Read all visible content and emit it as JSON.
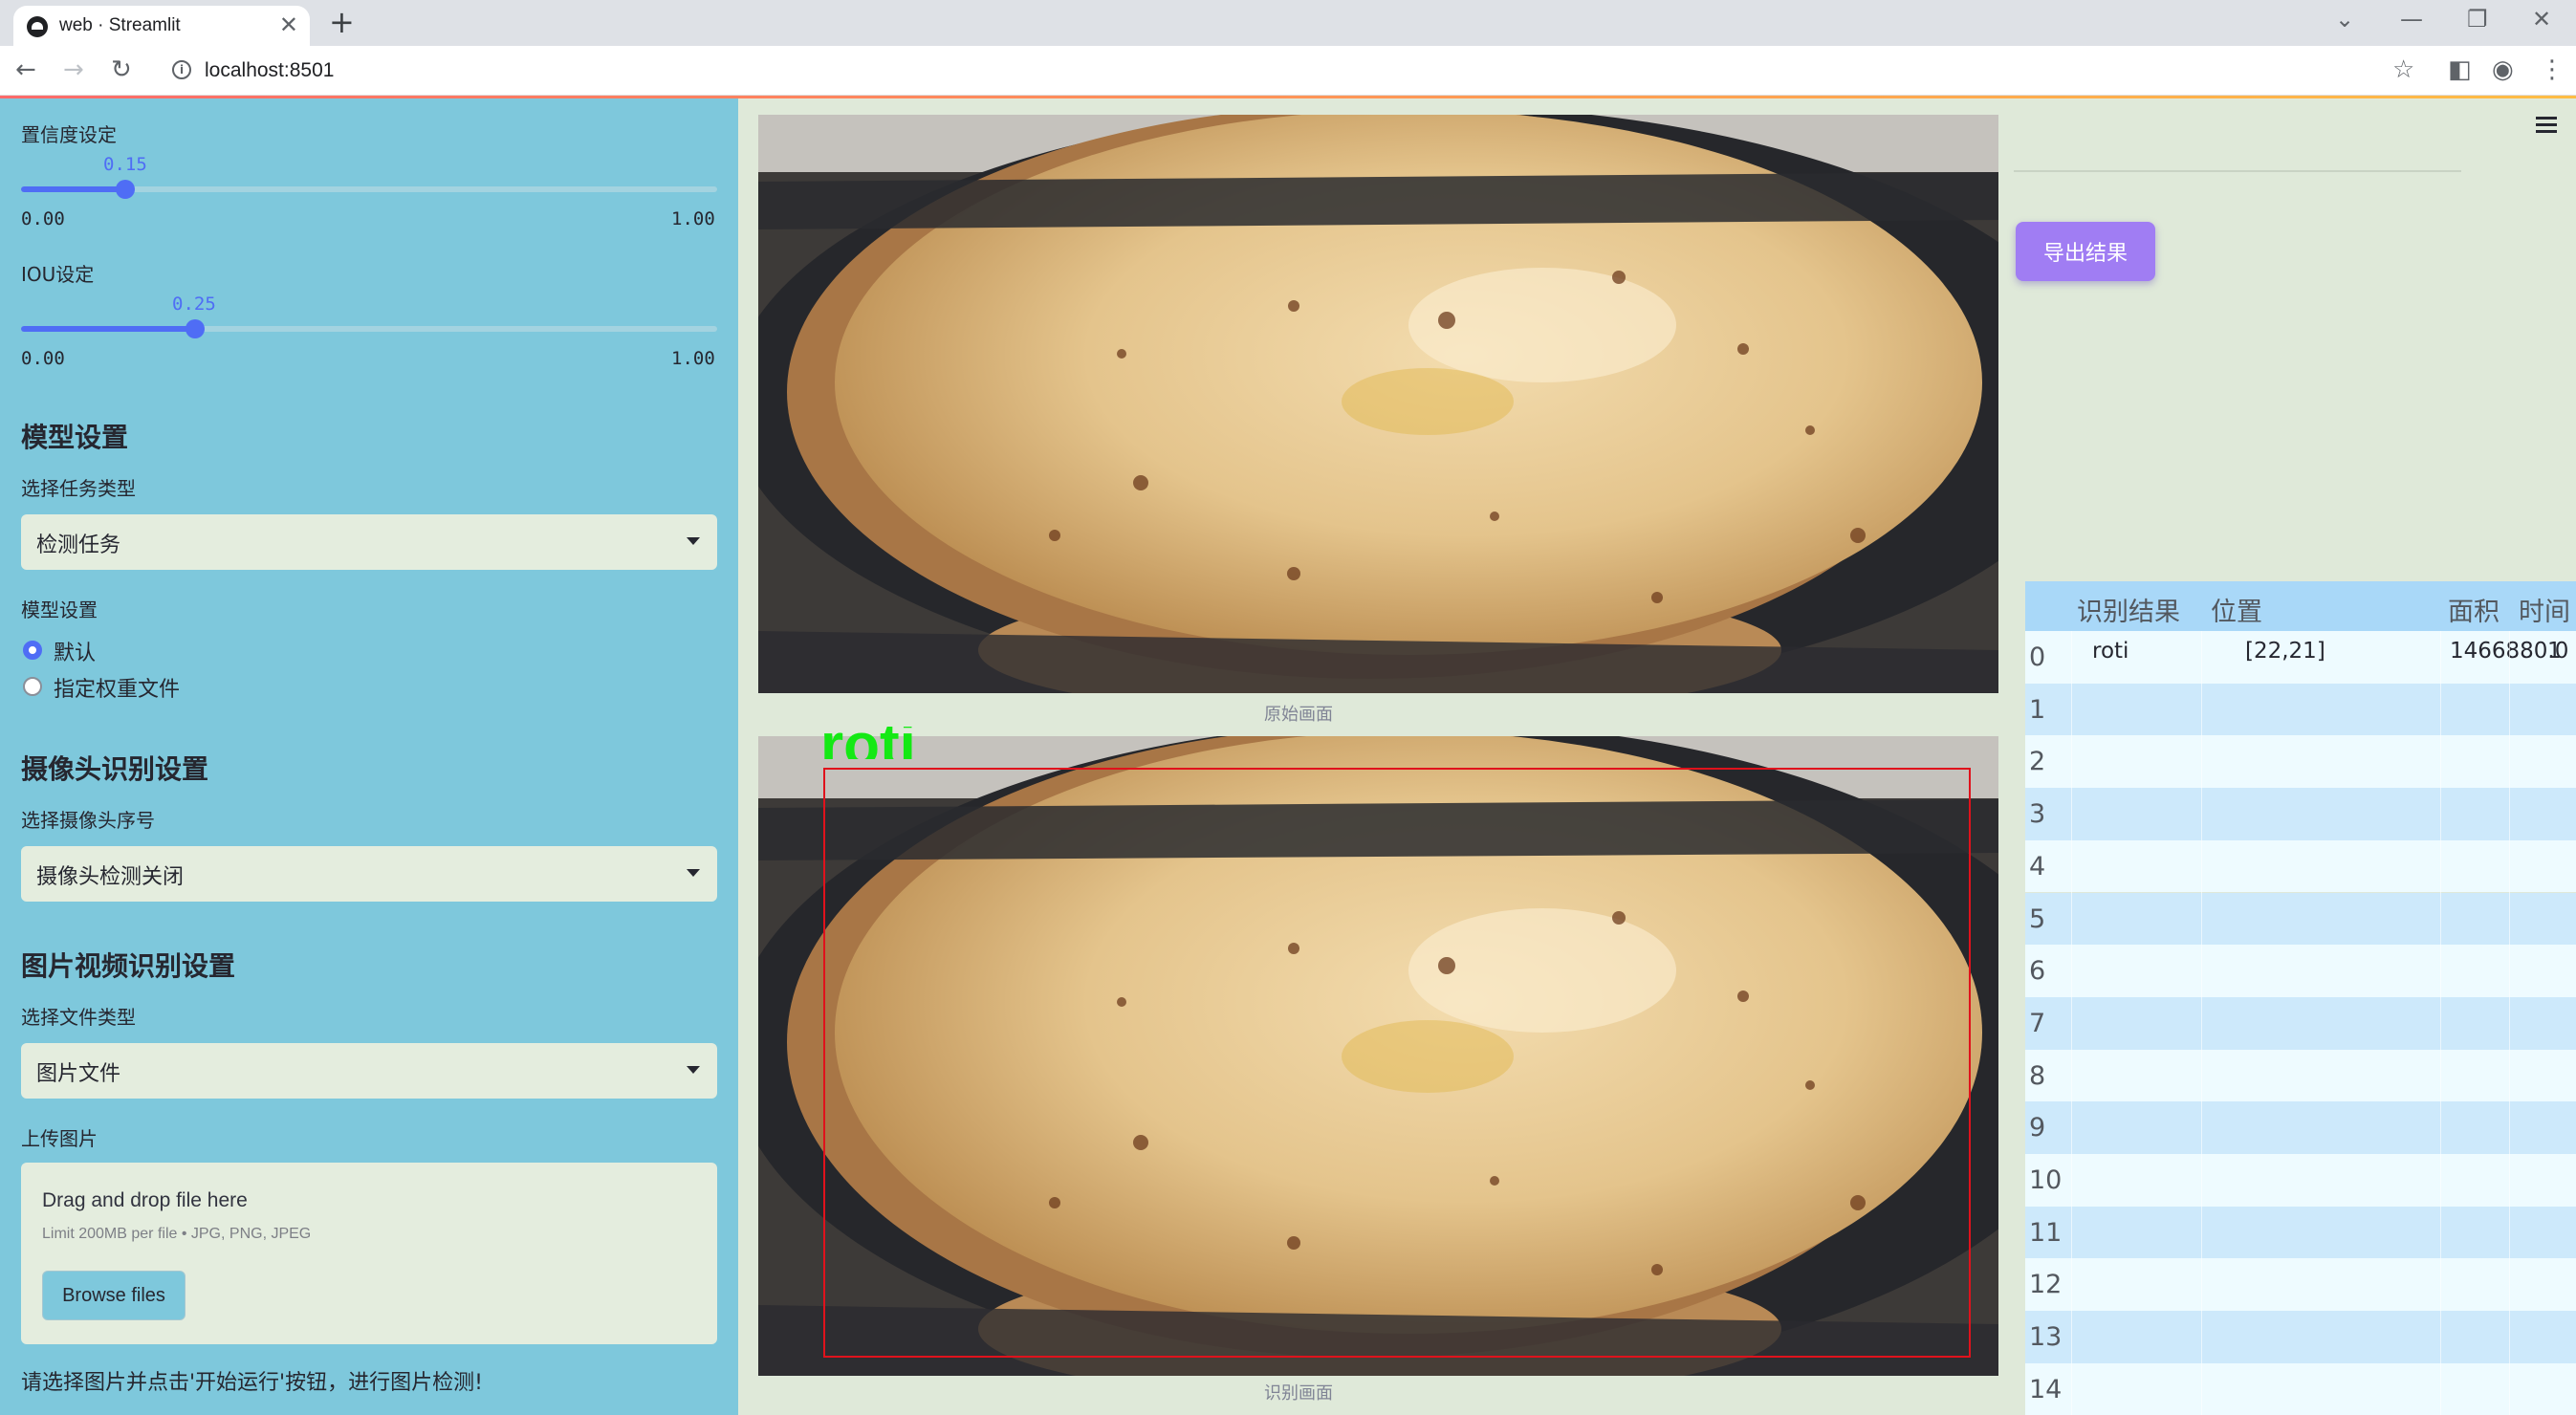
{
  "browser": {
    "tab_title": "web · Streamlit",
    "tab_close": "✕",
    "new_tab": "+",
    "url": "localhost:8501",
    "back": "←",
    "forward": "→",
    "reload": "↻",
    "bookmark": "☆",
    "side_panel": "◧",
    "profile": "◉",
    "menu": "⋮",
    "win_down": "⌄",
    "win_min": "—",
    "win_restore": "❐",
    "win_close": "✕"
  },
  "sidebar": {
    "confidence": {
      "label": "置信度设定",
      "value_text": "0.15",
      "value": 0.15,
      "min": "0.00",
      "max": "1.00"
    },
    "iou": {
      "label": "IOU设定",
      "value_text": "0.25",
      "value": 0.25,
      "min": "0.00",
      "max": "1.00"
    },
    "model_header": "模型设置",
    "task_label": "选择任务类型",
    "task_value": "检测任务",
    "model_label": "模型设置",
    "model_options": [
      "默认",
      "指定权重文件"
    ],
    "camera_header": "摄像头识别设置",
    "camera_label": "选择摄像头序号",
    "camera_value": "摄像头检测关闭",
    "media_header": "图片视频识别设置",
    "file_type_label": "选择文件类型",
    "file_type_value": "图片文件",
    "upload_label": "上传图片",
    "upload_title": "Drag and drop file here",
    "upload_limit": "Limit 200MB per file • JPG, PNG, JPEG",
    "browse_button": "Browse files",
    "footer_text": "请选择图片并点击'开始运行'按钮，进行图片检测!"
  },
  "main": {
    "original_caption": "原始画面",
    "result_caption": "识别画面",
    "detection_label": "roti",
    "export_button": "导出结果",
    "colors": {
      "box": "#e0121c",
      "label": "#14e914",
      "accent": "#4f6df5"
    }
  },
  "table": {
    "columns": [
      "识别结果",
      "位置",
      "面积",
      "时间"
    ],
    "rows": [
      {
        "idx": "0",
        "result": "roti",
        "position": "[22,21]",
        "area": "1466880.0",
        "time": "1"
      },
      {
        "idx": "1"
      },
      {
        "idx": "2"
      },
      {
        "idx": "3"
      },
      {
        "idx": "4"
      },
      {
        "idx": "5"
      },
      {
        "idx": "6"
      },
      {
        "idx": "7"
      },
      {
        "idx": "8"
      },
      {
        "idx": "9"
      },
      {
        "idx": "10"
      },
      {
        "idx": "11"
      },
      {
        "idx": "12"
      },
      {
        "idx": "13"
      },
      {
        "idx": "14"
      }
    ]
  }
}
